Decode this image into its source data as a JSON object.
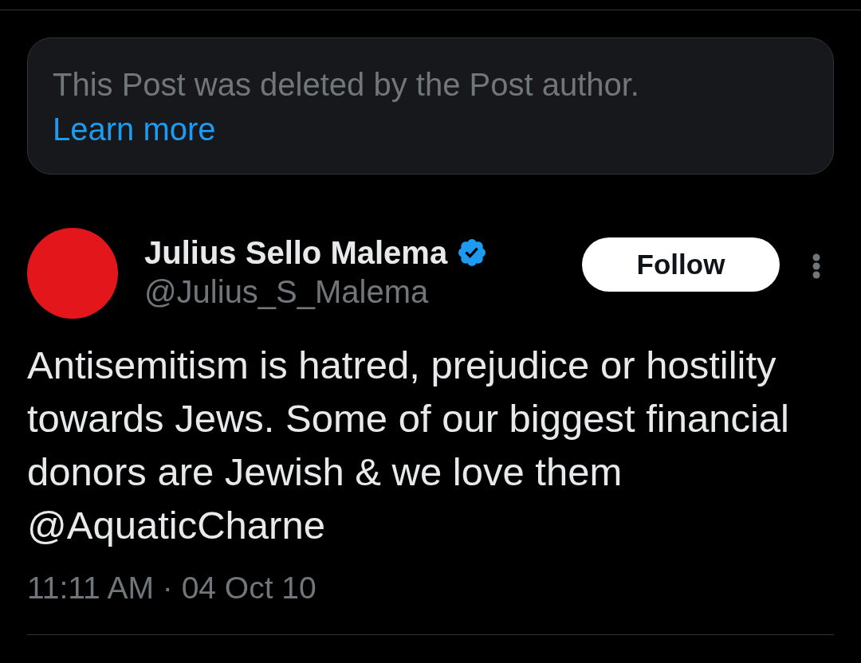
{
  "deleted_notice": {
    "text": "This Post was deleted by the Post author.",
    "link": "Learn more"
  },
  "post": {
    "author": {
      "name": "Julius Sello Malema",
      "verified": true,
      "handle": "@Julius_S_Malema"
    },
    "follow_button": "Follow",
    "text": "Antisemitism is hatred, prejudice or hostility towards Jews. Some of our biggest financial donors are Jewish & we love them @AquaticCharne",
    "timestamp": "11:11 AM · 04 Oct 10"
  }
}
